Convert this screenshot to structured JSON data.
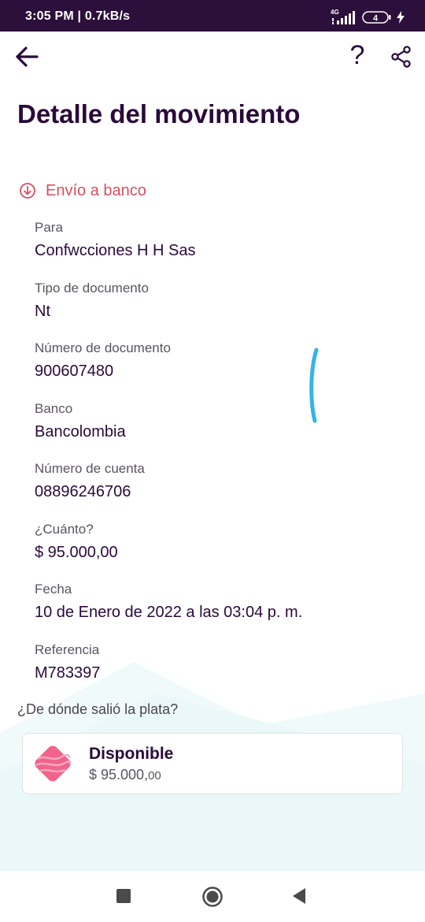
{
  "status_bar": {
    "time": "3:05 PM | 0.7kB/s",
    "network": "4G",
    "battery": "4"
  },
  "header": {
    "title": "Detalle del movimiento",
    "help_label": "?"
  },
  "transaction": {
    "type": "Envío a banco",
    "type_color": "#d84f5f",
    "fields": [
      {
        "label": "Para",
        "value": "Confwcciones H H Sas"
      },
      {
        "label": "Tipo de documento",
        "value": "Nt"
      },
      {
        "label": "Número de documento",
        "value": "900607480"
      },
      {
        "label": "Banco",
        "value": "Bancolombia"
      },
      {
        "label": "Número de cuenta",
        "value": "08896246706"
      },
      {
        "label": "¿Cuánto?",
        "value": "$ 95.000,00"
      },
      {
        "label": "Fecha",
        "value": "10 de Enero de 2022 a las 03:04 p. m."
      },
      {
        "label": "Referencia",
        "value": "M783397"
      }
    ]
  },
  "source": {
    "label": "¿De dónde salió la plata?",
    "account_name": "Disponible",
    "amount_main": "$ 95.000,",
    "amount_cents": "00",
    "icon": "pocket-icon"
  },
  "colors": {
    "primary_dark": "#2a0a3a",
    "status_bar": "#2c0f3a",
    "accent_pink": "#f0648c",
    "scroll_indicator": "#33b5e5"
  }
}
